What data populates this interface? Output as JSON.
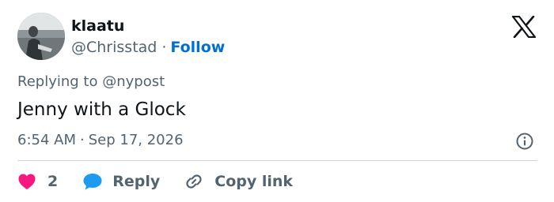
{
  "author": {
    "name": "klaatu",
    "handle": "@Chrisstad",
    "separator": "·",
    "follow_label": "Follow",
    "avatar_icon": "profile-photo"
  },
  "logo_icon": "x-logo-icon",
  "reply_context": {
    "prefix": "Replying to",
    "mention": "@nypost"
  },
  "tweet": {
    "text": "Jenny with a Glock",
    "time": "6:54 AM",
    "separator": "·",
    "date": "Sep 17, 2026"
  },
  "actions": {
    "like_count": "2",
    "reply_label": "Reply",
    "copy_link_label": "Copy link"
  },
  "colors": {
    "accent": "#006fd6",
    "like": "#f91880",
    "reply_bubble": "#1d9bf0",
    "secondary_text": "#536471",
    "primary_text": "#0f1419",
    "divider": "#cfd9de"
  }
}
